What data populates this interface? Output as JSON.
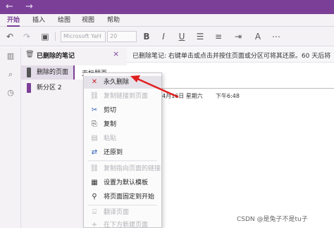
{
  "titlebar": {
    "back": "←",
    "forward": "→"
  },
  "ribbon": {
    "tabs": [
      {
        "label": "开始",
        "active": true
      },
      {
        "label": "插入",
        "active": false
      },
      {
        "label": "绘图",
        "active": false
      },
      {
        "label": "视图",
        "active": false
      },
      {
        "label": "帮助",
        "active": false
      }
    ]
  },
  "toolbar": {
    "font_name": "Microsoft YaH",
    "font_size": "20",
    "icons": [
      "undo-icon",
      "redo-icon",
      "clipboard-icon",
      "bold-icon",
      "italic-icon",
      "underline-icon",
      "bullet-list-icon",
      "numbered-list-icon",
      "indent-icon",
      "heading-style-icon",
      "more-icon"
    ]
  },
  "navpanel": {
    "title": "已删除的笔记",
    "close": "×",
    "sections": [
      {
        "label": "删除的页面",
        "color": "#555555",
        "active": true
      },
      {
        "label": "新分区 2",
        "color": "#7b3f98",
        "active": false
      }
    ],
    "page_label": "无标题页"
  },
  "content": {
    "info": "已删除笔记: 右键单击或点击并按住页面或分区可将其还原。60 天后将",
    "date": "4月16日 星期六",
    "time": "下午6:48"
  },
  "context_menu": {
    "items": [
      {
        "label": "永久删除",
        "icon": "delete-icon",
        "glyph": "🗋",
        "disabled": false,
        "hover": true
      },
      {
        "label": "复制链接到页面",
        "icon": "link-icon",
        "glyph": "⛓",
        "disabled": true
      },
      {
        "label": "剪切",
        "icon": "scissors-icon",
        "glyph": "✂",
        "disabled": false
      },
      {
        "label": "复制",
        "icon": "copy-icon",
        "glyph": "⎘",
        "disabled": false
      },
      {
        "label": "粘贴",
        "icon": "paste-icon",
        "glyph": "📋",
        "disabled": true
      },
      {
        "label": "还原到",
        "icon": "restore-icon",
        "glyph": "⇄",
        "disabled": false
      },
      {
        "label": "复制指向页面的链接",
        "icon": "page-link-icon",
        "glyph": "⛓",
        "disabled": true
      },
      {
        "label": "设置为默认模板",
        "icon": "template-icon",
        "glyph": "▤",
        "disabled": false
      },
      {
        "label": "将页面固定到开始",
        "icon": "pin-icon",
        "glyph": "📌",
        "disabled": false
      },
      {
        "label": "翻译页面",
        "icon": "translate-icon",
        "glyph": "⌸",
        "disabled": true
      },
      {
        "label": "在下方新建页面",
        "icon": "new-page-icon",
        "glyph": "+",
        "disabled": true
      }
    ]
  },
  "watermark": "CSDN @是兔子不是tu子",
  "colors": {
    "accent": "#7b3f98",
    "annotation": "#e02020"
  }
}
